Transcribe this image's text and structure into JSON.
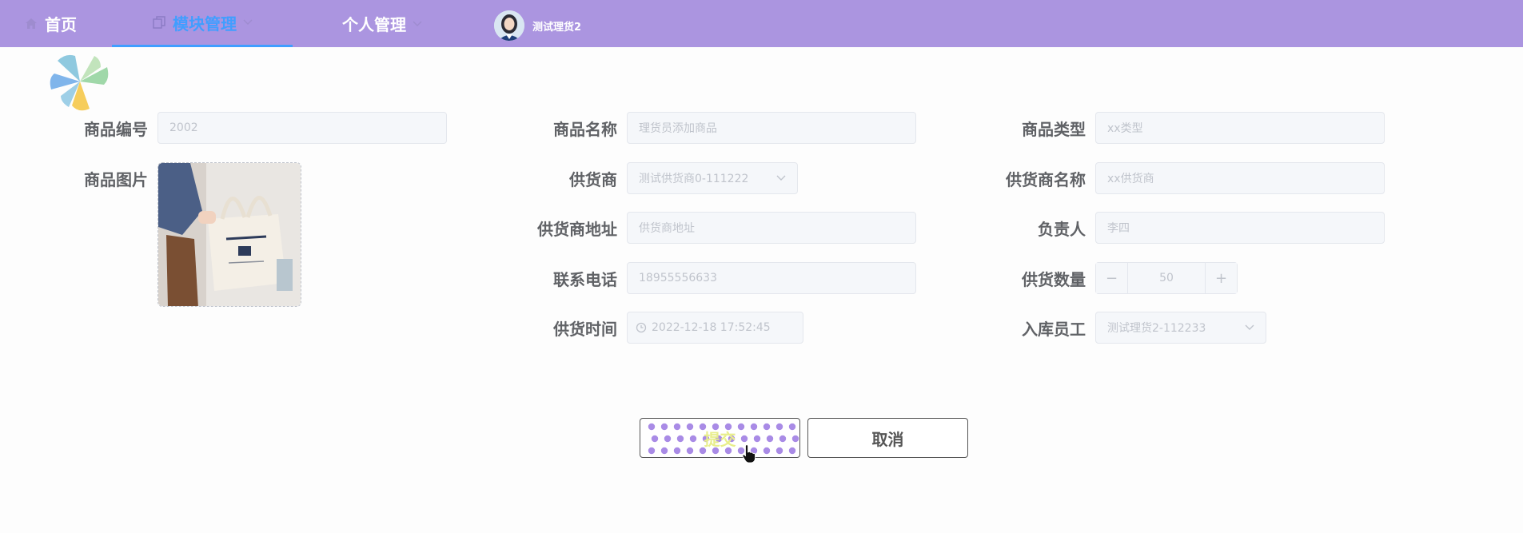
{
  "nav": {
    "home_label": "首页",
    "module_label": "模块管理",
    "personal_label": "个人管理",
    "user_name": "测试理货2",
    "active_color": "#409eff",
    "bar_color": "#ab95e0"
  },
  "form": {
    "product_code": {
      "label": "商品编号",
      "value": "2002"
    },
    "product_name": {
      "label": "商品名称",
      "value": "理货员添加商品"
    },
    "product_type": {
      "label": "商品类型",
      "value": "xx类型"
    },
    "product_image": {
      "label": "商品图片"
    },
    "supplier": {
      "label": "供货商",
      "value": "测试供货商0-111222"
    },
    "supplier_name": {
      "label": "供货商名称",
      "value": "xx供货商"
    },
    "supplier_address": {
      "label": "供货商地址",
      "value": "供货商地址"
    },
    "person_in_charge": {
      "label": "负责人",
      "value": "李四"
    },
    "phone": {
      "label": "联系电话",
      "value": "18955556633"
    },
    "supply_quantity": {
      "label": "供货数量",
      "value": "50",
      "minus": "−",
      "plus": "+"
    },
    "supply_time": {
      "label": "供货时间",
      "value": "2022-12-18 17:52:45"
    },
    "warehouse_staff": {
      "label": "入库员工",
      "value": "测试理货2-112233"
    }
  },
  "actions": {
    "submit_label": "提交",
    "cancel_label": "取消"
  },
  "icons": {
    "home": "home-icon",
    "module": "copy-icon",
    "chevron": "chevron-down-icon",
    "clock": "clock-icon",
    "cursor": "hand-pointer-icon"
  }
}
